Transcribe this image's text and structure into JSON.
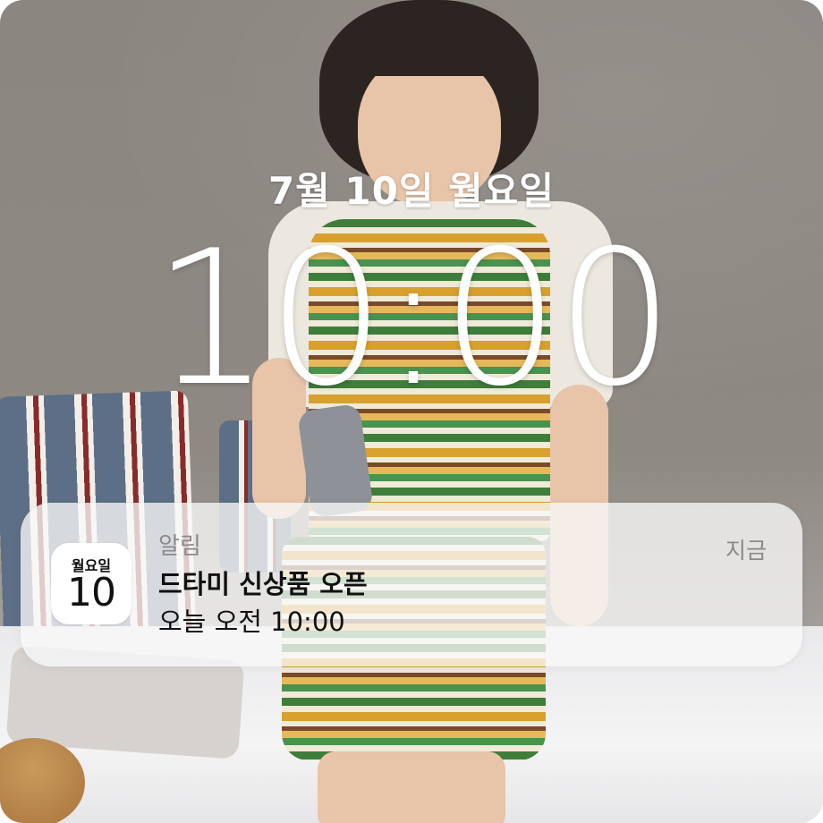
{
  "lockscreen": {
    "date": "7월 10일 월요일",
    "time": "10:00"
  },
  "notification": {
    "app_name": "알림",
    "time_ago": "지금",
    "title": "드타미 신상품 오픈",
    "body": "오늘 오전 10:00",
    "icon": {
      "name": "calendar-icon",
      "weekday": "월요일",
      "day": "10"
    }
  }
}
